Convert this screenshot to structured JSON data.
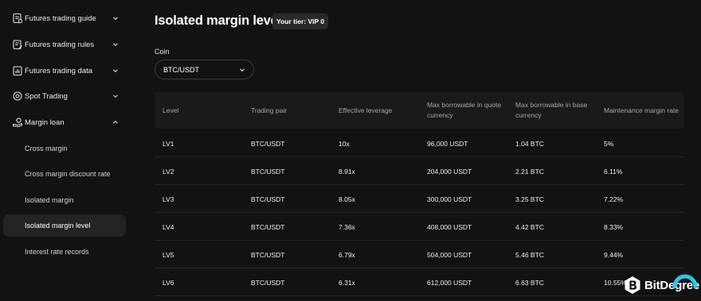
{
  "sidebar": {
    "sections": [
      {
        "label": "Futures trading guide",
        "icon": "document-icon",
        "expanded": false
      },
      {
        "label": "Futures trading rules",
        "icon": "rules-icon",
        "expanded": false
      },
      {
        "label": "Futures trading data",
        "icon": "data-icon",
        "expanded": false
      },
      {
        "label": "Spot Trading",
        "icon": "coin-icon",
        "expanded": false
      },
      {
        "label": "Margin loan",
        "icon": "hand-coin-icon",
        "expanded": true
      }
    ],
    "sub_items": [
      {
        "label": "Cross margin",
        "active": false
      },
      {
        "label": "Cross margin discount rate",
        "active": false
      },
      {
        "label": "Isolated margin",
        "active": false
      },
      {
        "label": "Isolated margin level",
        "active": true
      },
      {
        "label": "Interest rate records",
        "active": false
      }
    ]
  },
  "main": {
    "title": "Isolated margin level",
    "tier_badge": "Your tier: VIP 0",
    "coin_label": "Coin",
    "coin_value": "BTC/USDT"
  },
  "table": {
    "headers": [
      "Level",
      "Trading pair",
      "Effective leverage",
      "Max borrowable in quote currency",
      "Max borrowable in base currency",
      "Maintenance margin rate"
    ],
    "rows": [
      [
        "LV1",
        "BTC/USDT",
        "10x",
        "96,000 USDT",
        "1.04 BTC",
        "5%"
      ],
      [
        "LV2",
        "BTC/USDT",
        "8.91x",
        "204,000 USDT",
        "2.21 BTC",
        "6.11%"
      ],
      [
        "LV3",
        "BTC/USDT",
        "8.05x",
        "300,000 USDT",
        "3.25 BTC",
        "7.22%"
      ],
      [
        "LV4",
        "BTC/USDT",
        "7.36x",
        "408,000 USDT",
        "4.42 BTC",
        "8.33%"
      ],
      [
        "LV5",
        "BTC/USDT",
        "6.79x",
        "504,000 USDT",
        "5.46 BTC",
        "9.44%"
      ],
      [
        "LV6",
        "BTC/USDT",
        "6.31x",
        "612,000 USDT",
        "6.63 BTC",
        "10.55%"
      ]
    ]
  },
  "watermark": {
    "text": "BitDegree",
    "accent_color": "#2ec5e6"
  }
}
